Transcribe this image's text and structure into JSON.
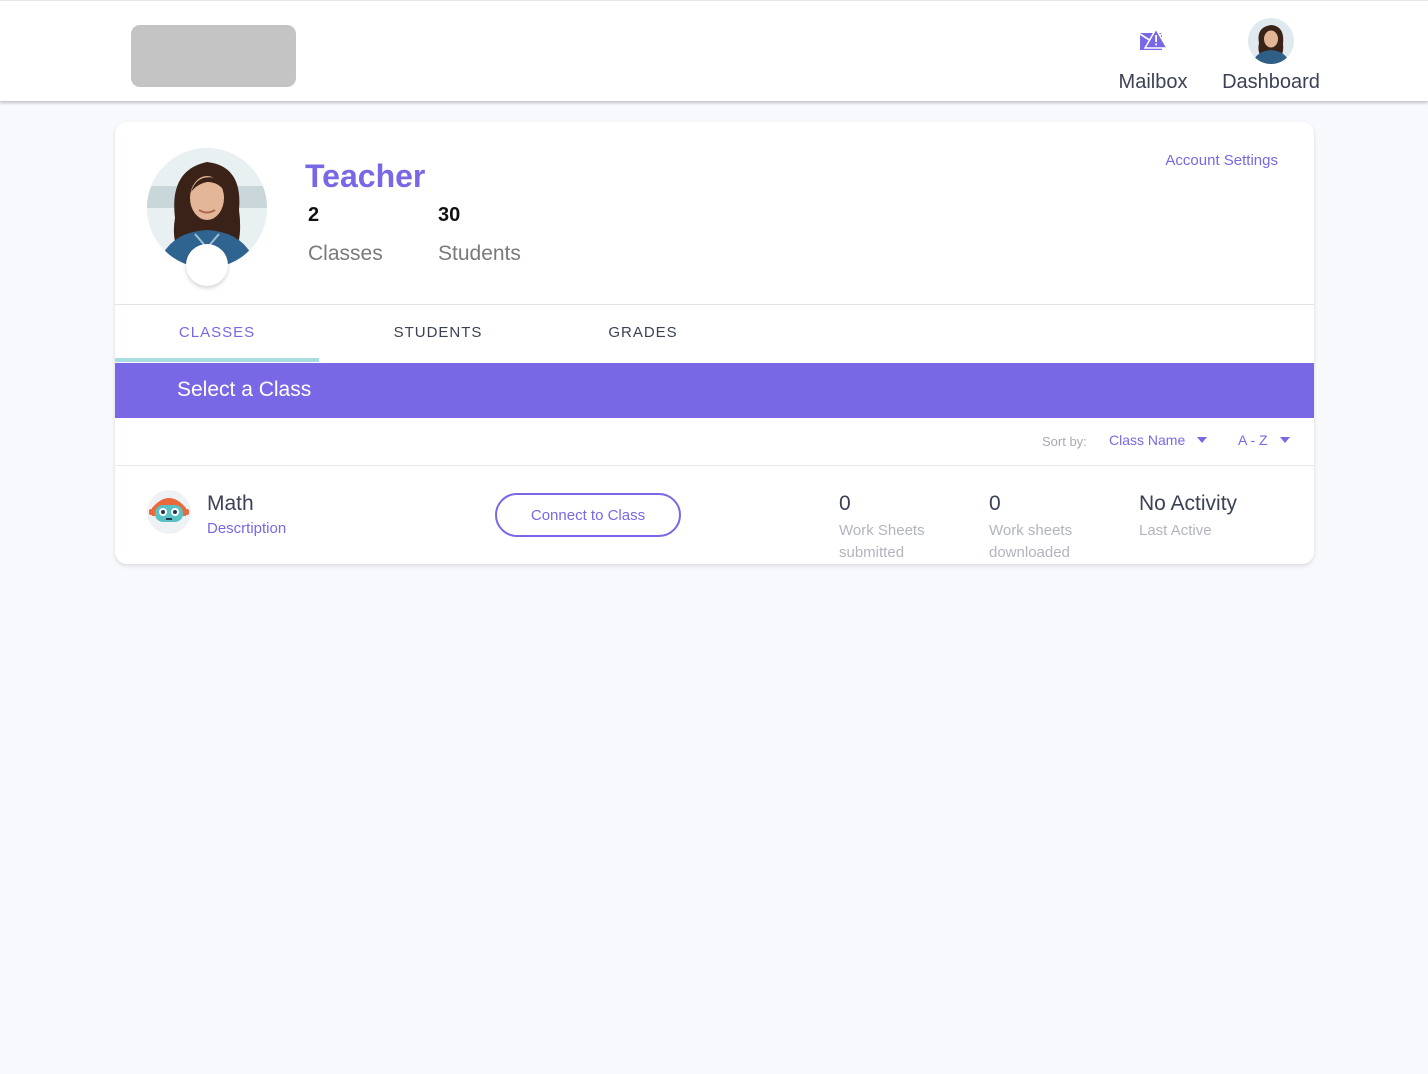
{
  "header": {
    "nav": [
      {
        "label": "Mailbox",
        "icon": "mailbox-icon"
      },
      {
        "label": "Dashboard",
        "icon": "avatar"
      }
    ]
  },
  "profile": {
    "role": "Teacher",
    "stats": [
      {
        "value": "2",
        "label": "Classes"
      },
      {
        "value": "30",
        "label": "Students"
      }
    ],
    "account_settings_label": "Account Settings"
  },
  "tabs": [
    {
      "label": "CLASSES",
      "active": true
    },
    {
      "label": "STUDENTS",
      "active": false
    },
    {
      "label": "GRADES",
      "active": false
    }
  ],
  "banner": {
    "title": "Select a Class"
  },
  "sort": {
    "label": "Sort by:",
    "field": "Class Name",
    "order": "A - Z"
  },
  "classes": [
    {
      "name": "Math",
      "description": "Descrtiption",
      "connect_label": "Connect to Class",
      "worksheets_submitted": {
        "value": "0",
        "label_line1": "Work Sheets",
        "label_line2": "submitted"
      },
      "worksheets_downloaded": {
        "value": "0",
        "label_line1": "Work sheets",
        "label_line2": "downloaded"
      },
      "activity": {
        "value": "No Activity",
        "label": "Last Active"
      }
    }
  ],
  "colors": {
    "accent": "#7868e6",
    "tab_indicator": "#a8dde2",
    "logo_placeholder": "#c4c4c4",
    "page_background": "#f8f9fc"
  }
}
